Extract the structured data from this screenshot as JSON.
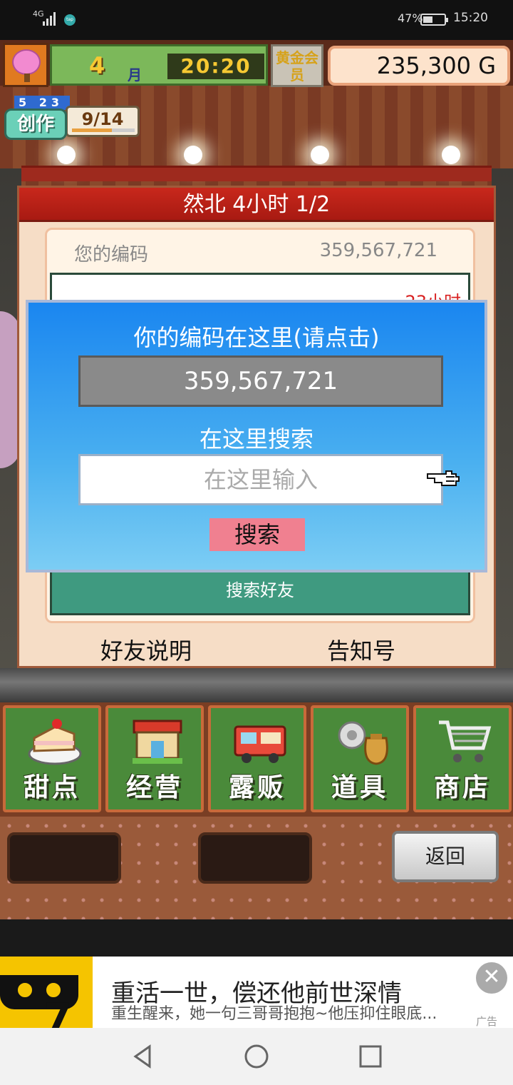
{
  "status_bar": {
    "network": "4G",
    "battery_percent": "47%",
    "time": "15:20"
  },
  "hud": {
    "month_number": "4",
    "month_unit": "月",
    "clock": "20:20",
    "gold_member_label": "黄金会员",
    "money": "235,300 G",
    "create_days": "5 23",
    "create_label": "创作",
    "create_progress": "9/14",
    "create_progress_fraction": 0.64
  },
  "panel": {
    "title": "然北  4小时 1/2",
    "your_code_label": "您的编码",
    "your_code_value": "359,567,721",
    "list_peek_text": "23小时",
    "search_friend_label": "搜索好友",
    "friend_help_label": "好友说明",
    "notice_label": "告知号"
  },
  "dialog": {
    "title": "你的编码在这里(请点击)",
    "code": "359,567,721",
    "search_label": "在这里搜索",
    "input_placeholder": "在这里输入",
    "search_button": "搜索"
  },
  "menu": {
    "items": [
      {
        "label": "甜点",
        "icon": "cake-icon"
      },
      {
        "label": "经营",
        "icon": "shop-icon"
      },
      {
        "label": "露贩",
        "icon": "food-truck-icon"
      },
      {
        "label": "道具",
        "icon": "items-bag-icon"
      },
      {
        "label": "商店",
        "icon": "shopping-cart-icon"
      }
    ],
    "back_label": "返回"
  },
  "ad": {
    "title": "重活一世，偿还他前世深情",
    "subtitle": "重生醒来，她一句三哥哥抱抱~他压抑住眼底...",
    "tag": "广告"
  },
  "colors": {
    "dialog_top": "#1a86f0",
    "search_button": "#f08090",
    "panel_header": "#c8281c",
    "menu_green": "#4a8a3a"
  }
}
